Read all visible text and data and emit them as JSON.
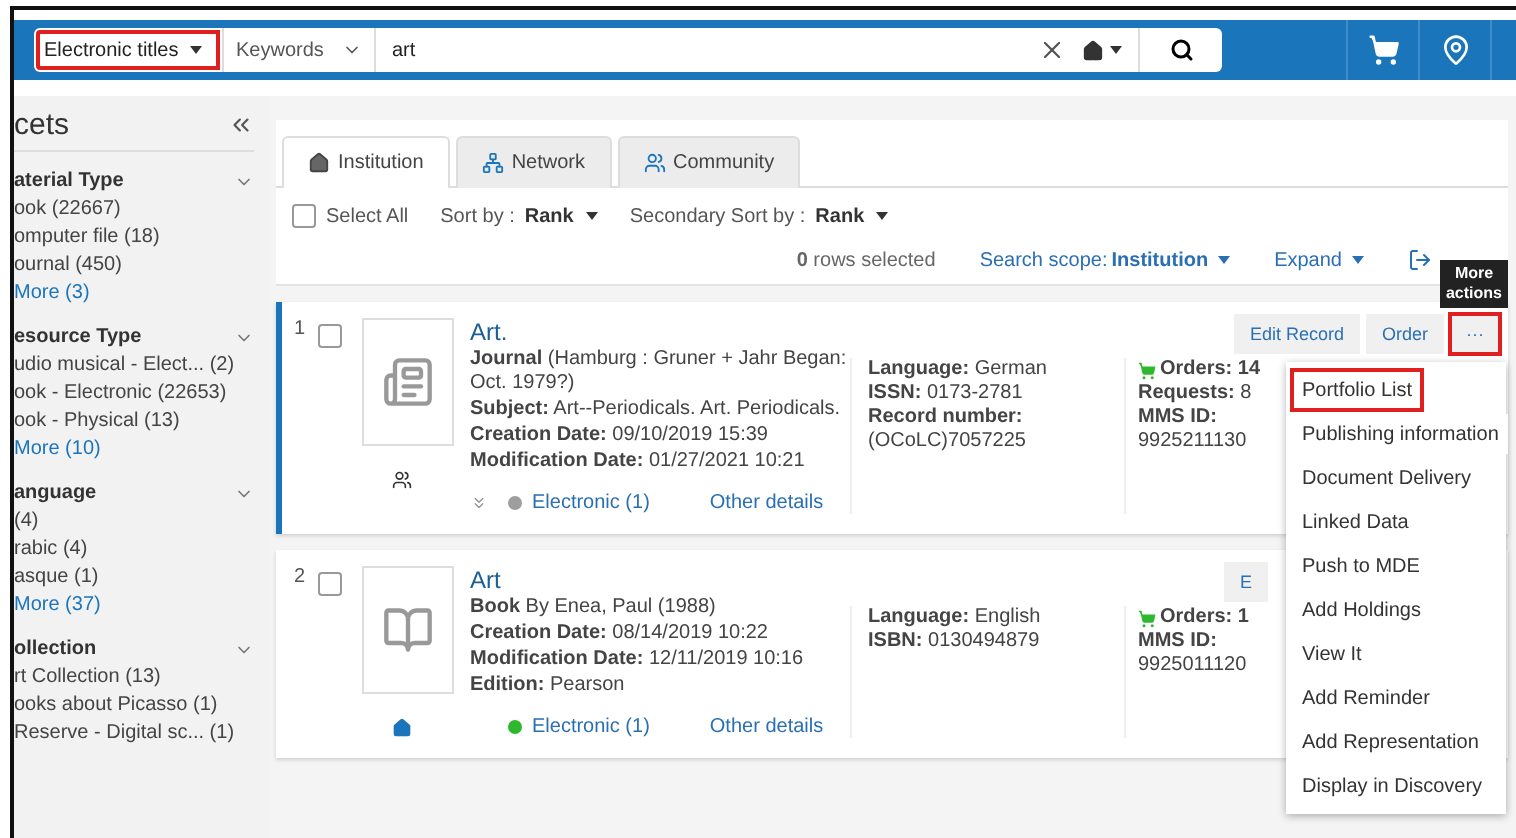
{
  "search_bar": {
    "scope": "Electronic titles",
    "scope_highlighted": true,
    "field": "Keywords",
    "value": "art"
  },
  "facets": {
    "title": "cets",
    "groups": [
      {
        "title": "aterial Type",
        "expanded": true,
        "items": [
          "ook (22667)",
          "omputer file (18)",
          "ournal (450)"
        ],
        "more": "More (3)"
      },
      {
        "title": "esource Type",
        "expanded": true,
        "items": [
          "udio musical - Elect... (2)",
          "ook - Electronic (22653)",
          "ook - Physical (13)"
        ],
        "more": "More (10)"
      },
      {
        "title": "anguage",
        "expanded": true,
        "items": [
          "(4)",
          "rabic (4)",
          "asque (1)"
        ],
        "more": "More (37)"
      },
      {
        "title": "ollection",
        "expanded": true,
        "items": [
          "rt Collection (13)",
          "ooks about Picasso (1)",
          "Reserve - Digital sc... (1)"
        ]
      }
    ]
  },
  "tabs": [
    {
      "label": "Institution",
      "kind": "institution",
      "selected": true
    },
    {
      "label": "Network",
      "kind": "network",
      "selected": false
    },
    {
      "label": "Community",
      "kind": "community",
      "selected": false
    }
  ],
  "toolbar": {
    "select_all": {
      "label": "Select All",
      "checked": false
    },
    "sort": {
      "label": "Sort by :",
      "value": "Rank"
    },
    "secondary_sort": {
      "label": "Secondary Sort by :",
      "value": "Rank"
    }
  },
  "selection": {
    "count": "0",
    "label": "rows selected",
    "scope_label": "Search scope:",
    "scope_value": "Institution",
    "expand": "Expand"
  },
  "tooltip": "More actions",
  "records": [
    {
      "number": "1",
      "checked": false,
      "active": true,
      "thumbnail": {
        "kind": "journal"
      },
      "badge": {
        "kind": "community"
      },
      "title": "Art.",
      "lines": [
        "**Journal** (Hamburg : Gruner + Jahr Began: Oct. 1979?)",
        "**Subject:** Art--Periodicals. Art. Periodicals.",
        "**Creation Date:** 09/10/2019 15:39",
        "**Modification Date:** 01/27/2021 10:21"
      ],
      "details": [
        "**Language:** German",
        "**ISSN:** 0173-2781",
        "**Record number:** (OCoLC)7057225"
      ],
      "orders": "Orders: 14",
      "stats": [
        "**Requests:** 8",
        "**MMS ID:** 9925211130"
      ],
      "expandable": true,
      "availability": {
        "label": "Electronic (1)",
        "color": "#9e9e9e"
      },
      "other": "Other details",
      "actions": [
        {
          "label": "Edit Record",
          "kind": "text",
          "highlighted": false
        },
        {
          "label": "Order",
          "kind": "text",
          "highlighted": false
        },
        {
          "label": "···",
          "kind": "more",
          "highlighted": true
        }
      ]
    },
    {
      "number": "2",
      "checked": false,
      "active": false,
      "thumbnail": {
        "kind": "book"
      },
      "badge": {
        "kind": "institution"
      },
      "title": "Art",
      "lines": [
        "**Book** By Enea, Paul (1988)",
        "**Creation Date:** 08/14/2019 10:22",
        "**Modification Date:** 12/11/2019 10:16",
        "**Edition:** Pearson"
      ],
      "details": [
        "**Language:** English",
        "**ISBN:** 0130494879"
      ],
      "orders": "Orders: 1",
      "stats": [
        "**MMS ID:** 9925011120"
      ],
      "expandable": false,
      "availability": {
        "label": "Electronic (1)",
        "color": "#2eb82e"
      },
      "other": "Other details",
      "actions": [
        {
          "label": "E",
          "kind": "text",
          "highlighted": false
        }
      ]
    }
  ],
  "menu": [
    {
      "label": "Portfolio List",
      "highlighted": true
    },
    {
      "label": "Publishing information",
      "highlighted": false
    },
    {
      "label": "Document Delivery",
      "highlighted": false
    },
    {
      "label": "Linked Data",
      "highlighted": false
    },
    {
      "label": "Push to MDE",
      "highlighted": false
    },
    {
      "label": "Add Holdings",
      "highlighted": false
    },
    {
      "label": "View It",
      "highlighted": false
    },
    {
      "label": "Add Reminder",
      "highlighted": false
    },
    {
      "label": "Add Representation",
      "highlighted": false
    },
    {
      "label": "Display in Discovery",
      "highlighted": false
    }
  ]
}
